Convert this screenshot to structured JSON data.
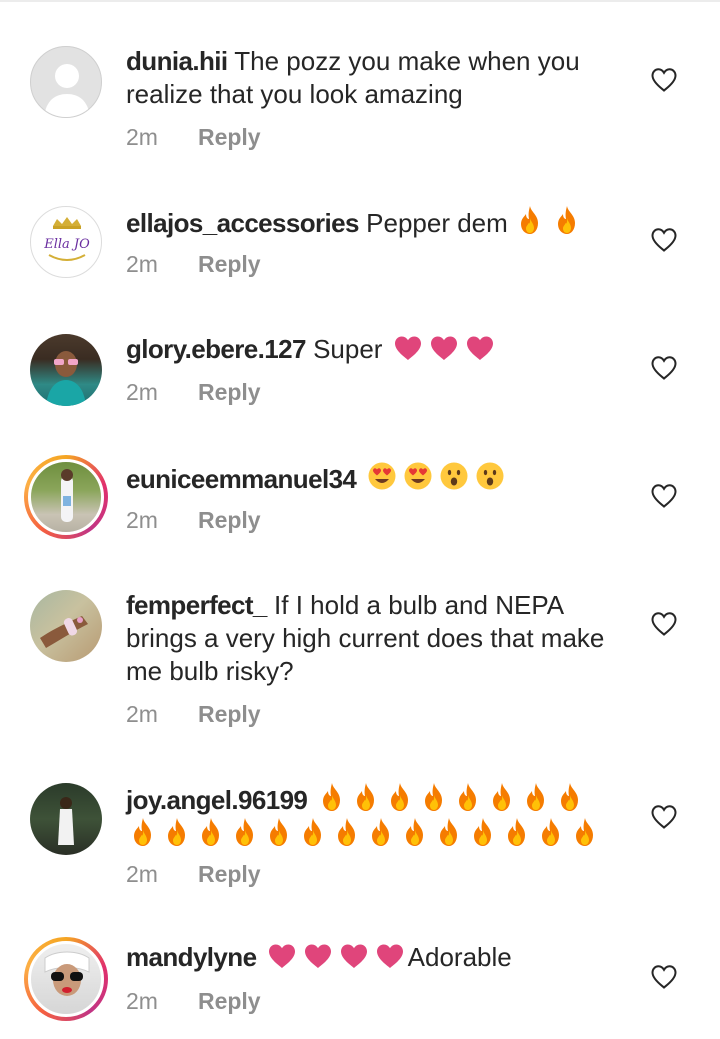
{
  "comments": [
    {
      "username": "dunia.hii",
      "text": "The pozz you make when you realize that you look amazing",
      "time": "2m",
      "reply_label": "Reply",
      "avatar": "default-avatar-icon",
      "emojis": []
    },
    {
      "username": "ellajos_accessories",
      "text": "Pepper dem",
      "time": "2m",
      "reply_label": "Reply",
      "avatar": "ella-jo-logo",
      "avatar_logo_text": "Ella JO",
      "emojis": [
        "fire",
        "fire"
      ]
    },
    {
      "username": "glory.ebere.127",
      "text": "Super",
      "time": "2m",
      "reply_label": "Reply",
      "avatar": "photo",
      "emojis": [
        "pink-heart",
        "pink-heart",
        "pink-heart"
      ]
    },
    {
      "username": "euniceemmanuel34",
      "text": "",
      "time": "2m",
      "reply_label": "Reply",
      "avatar": "photo-story-ring",
      "emojis": [
        "heart-eyes",
        "heart-eyes",
        "hushed-face",
        "hushed-face"
      ]
    },
    {
      "username": "femperfect_",
      "text": "If I hold a bulb and NEPA brings a very high current does that make me bulb risky?",
      "time": "2m",
      "reply_label": "Reply",
      "avatar": "photo",
      "emojis": []
    },
    {
      "username": "joy.angel.96199",
      "text": "",
      "time": "2m",
      "reply_label": "Reply",
      "avatar": "photo",
      "emoji_count": 22,
      "emojis_name": "fire"
    },
    {
      "username": "mandylyne",
      "text": "Adorable",
      "time": "2m",
      "reply_label": "Reply",
      "avatar": "photo-story-ring",
      "emojis_before_text": [
        "pink-heart",
        "pink-heart",
        "pink-heart",
        "pink-heart"
      ]
    }
  ],
  "icons": {
    "like": "heart-outline-icon",
    "fire": "fire-emoji",
    "heart": "pink-heart-emoji",
    "heart_eyes": "heart-eyes-emoji",
    "hushed": "hushed-face-emoji"
  },
  "colors": {
    "text": "#262626",
    "meta": "#8e8e8e",
    "heart_emoji": "#e0457b",
    "fire_outer": "#f57c00",
    "fire_inner": "#ffc107",
    "emoji_face": "#ffc83d"
  }
}
